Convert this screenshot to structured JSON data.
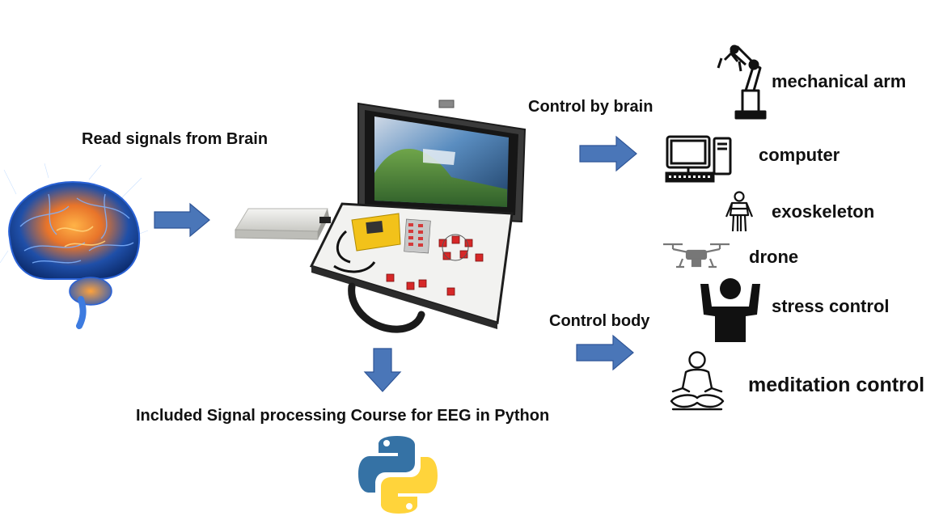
{
  "labels": {
    "read_signals": "Read signals from Brain",
    "control_by_brain": "Control by brain",
    "control_body": "Control body",
    "course": "Included Signal processing Course for EEG in Python"
  },
  "outputs": [
    {
      "label": "mechanical arm",
      "icon": "robot-arm-icon"
    },
    {
      "label": "computer",
      "icon": "desktop-computer-icon"
    },
    {
      "label": "exoskeleton",
      "icon": "exoskeleton-icon"
    },
    {
      "label": "drone",
      "icon": "drone-icon"
    },
    {
      "label": "stress control",
      "icon": "person-arms-raised-icon"
    },
    {
      "label": "meditation control",
      "icon": "meditation-icon"
    }
  ],
  "images": {
    "brain": "brain-illustration",
    "device": "eeg-kit-suitcase-with-screen",
    "battery": "power-bank",
    "python": "python-logo"
  },
  "colors": {
    "arrow": "#4a76b8",
    "arrow_stroke": "#2f5597",
    "python_blue": "#3572a5",
    "python_yellow": "#ffd43b"
  }
}
